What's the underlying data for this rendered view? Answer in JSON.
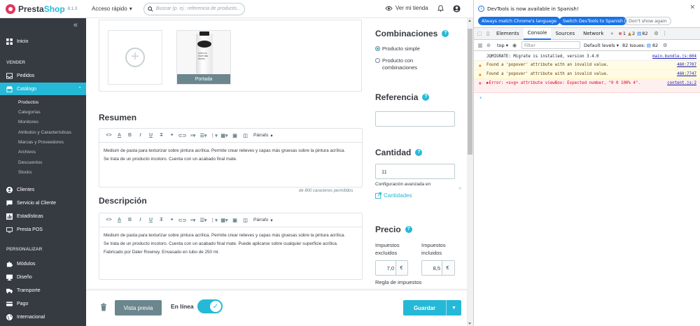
{
  "header": {
    "logo_text_1": "Presta",
    "logo_text_2": "Shop",
    "version": "8.1.3",
    "quick_access": "Acceso rápido",
    "search_placeholder": "Buscar (p. ej.: referencia de producto...",
    "view_store": "Ver mi tienda"
  },
  "sidebar": {
    "collapse": "«",
    "items_top": [
      {
        "label": "Inicio"
      }
    ],
    "section_sell": "VENDER",
    "sell_items": [
      {
        "label": "Pedidos"
      },
      {
        "label": "Catálogo"
      }
    ],
    "catalog_sub": [
      {
        "label": "Productos"
      },
      {
        "label": "Categorías"
      },
      {
        "label": "Monitoreo"
      },
      {
        "label": "Atributos y Características"
      },
      {
        "label": "Marcas y Proveedores"
      },
      {
        "label": "Archivos"
      },
      {
        "label": "Descuentos"
      },
      {
        "label": "Stocks"
      }
    ],
    "more_items": [
      {
        "label": "Clientes"
      },
      {
        "label": "Servicio al Cliente"
      },
      {
        "label": "Estadísticas"
      },
      {
        "label": "Presta POS"
      }
    ],
    "section_customize": "PERSONALIZAR",
    "customize_items": [
      {
        "label": "Módulos"
      },
      {
        "label": "Diseño"
      },
      {
        "label": "Transporte"
      },
      {
        "label": "Pago"
      },
      {
        "label": "Internacional"
      }
    ]
  },
  "images": {
    "cover_label": "Portada",
    "tube_brand": "ACRYLIC",
    "tube_text": "TEXTURE PASTE"
  },
  "summary": {
    "title": "Resumen",
    "paragraph_select": "Párrafo",
    "paragraphs": [
      "Medium de pasta para texturizar sobre pintura acrílica. Permite crear relieves y capas más gruesas sobre la pintura acrílica.",
      "Se trata de un producto incoloro. Cuenta con un acabado final mate."
    ],
    "counter": "de 800 caracteres permitidos"
  },
  "description": {
    "title": "Descripción",
    "paragraph_select": "Párrafo",
    "paragraphs": [
      "Medium de pasta para texturizar sobre pintura acrílica. Permite crear relieves y capas más gruesas sobre la pintura acrílica.",
      "Se trata de un producto incoloro. Cuenta con un acabado final mate. Puede aplicarse sobre cualquier superficie acrílica.",
      "Fabricado por Daler Rowney. Envasado en tubo de 250 ml."
    ]
  },
  "right": {
    "combinations_title": "Combinaciones",
    "simple_product": "Producto simple",
    "with_combinations": "Producto con combinaciones",
    "reference_title": "Referencia",
    "reference_value": "",
    "quantity_title": "Cantidad",
    "quantity_value": "11",
    "advanced_stock": "Configuración avanzada en",
    "quantities_link": "Cantidades",
    "price_title": "Precio",
    "tax_excl": "Impuestos excluidos",
    "tax_incl": "Impuestos incluidos",
    "price_excl": "7,0",
    "price_incl": "8,5",
    "currency": "€",
    "tax_rule": "Regla de impuestos"
  },
  "footer": {
    "preview": "Vista previa",
    "online": "En línea",
    "online_state": true,
    "save": "Guardar"
  },
  "devtools": {
    "info": "DevTools is now available in Spanish!",
    "btn_match": "Always match Chrome's language",
    "btn_switch": "Switch DevTools to Spanish",
    "btn_dismiss": "Don't show again",
    "tabs": [
      "Elements",
      "Console",
      "Sources",
      "Network"
    ],
    "active_tab": "Console",
    "errors": "1",
    "warnings": "2",
    "messages": "82",
    "context": "top",
    "filter_placeholder": "Filter",
    "levels": "Default levels",
    "issues": "82 Issues:",
    "issues_count": "82",
    "logs": [
      {
        "type": "info",
        "text": "JQMIGRATE: Migrate is installed, version 3.4.0",
        "src": "main.bundle.js:604"
      },
      {
        "type": "warn",
        "text": "Found a 'popover' attribute with an invalid value.",
        "src": "460:7707"
      },
      {
        "type": "warn",
        "text": "Found a 'popover' attribute with an invalid value.",
        "src": "460:7747"
      },
      {
        "type": "err",
        "text": "▶Error: <svg> attribute viewBox: Expected number, \"0 0 100% 4\".",
        "src": "content.js:2"
      }
    ]
  },
  "colors": {
    "accent": "#25b9d7",
    "sidebar_bg": "#363a41",
    "secondary": "#6c868e",
    "devtools_blue": "#1a73e8"
  }
}
